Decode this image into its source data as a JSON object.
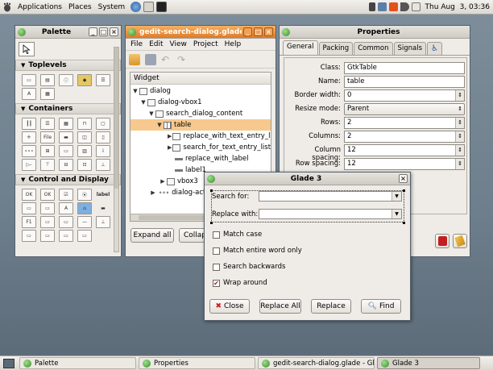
{
  "top_panel": {
    "menus": [
      "Applications",
      "Places",
      "System"
    ],
    "clock": "Thu Aug  3, 03:36"
  },
  "palette": {
    "title": "Palette",
    "sections": [
      "Toplevels",
      "Containers",
      "Control and Display"
    ],
    "control_icon_labels": [
      "OK",
      "OK",
      "",
      "",
      "label",
      "F1"
    ]
  },
  "editor": {
    "title": "gedit-search-dialog.glade",
    "menu": [
      "File",
      "Edit",
      "View",
      "Project",
      "Help"
    ],
    "tree_header": "Widget",
    "tree": [
      "dialog",
      "dialog-vbox1",
      "search_dialog_content",
      "table",
      "replace_with_text_entry_list",
      "search_for_text_entry_list",
      "replace_with_label",
      "label1",
      "vbox3",
      "dialog-actio"
    ],
    "expand_all": "Expand all",
    "collapse_partial": "Collap"
  },
  "properties": {
    "title": "Properties",
    "tabs": [
      "General",
      "Packing",
      "Common",
      "Signals"
    ],
    "rows": [
      {
        "label": "Class:",
        "value": "GtkTable"
      },
      {
        "label": "Name:",
        "value": "table"
      },
      {
        "label": "Border width:",
        "value": "0"
      },
      {
        "label": "Resize mode:",
        "value": "Parent"
      },
      {
        "label": "Rows:",
        "value": "2"
      },
      {
        "label": "Columns:",
        "value": "2"
      },
      {
        "label": "Column spacing:",
        "value": "12"
      },
      {
        "label": "Row spacing:",
        "value": "12"
      }
    ]
  },
  "dialog": {
    "title": "Glade 3",
    "search_label": "Search for:",
    "replace_label": "Replace with:",
    "checks": [
      {
        "label": "Match case",
        "checked": false
      },
      {
        "label": "Match entire word only",
        "checked": false
      },
      {
        "label": "Search backwards",
        "checked": false
      },
      {
        "label": "Wrap around",
        "checked": true
      }
    ],
    "buttons": [
      "Close",
      "Replace All",
      "Replace",
      "Find"
    ]
  },
  "taskbar": {
    "items": [
      "Palette",
      "Properties",
      "gedit-search-dialog.glade - Gla...",
      "Glade 3"
    ]
  },
  "colors": {
    "accent": "#e07a24",
    "selection": "#f7c98e",
    "desktop": "#6e7f8d"
  }
}
